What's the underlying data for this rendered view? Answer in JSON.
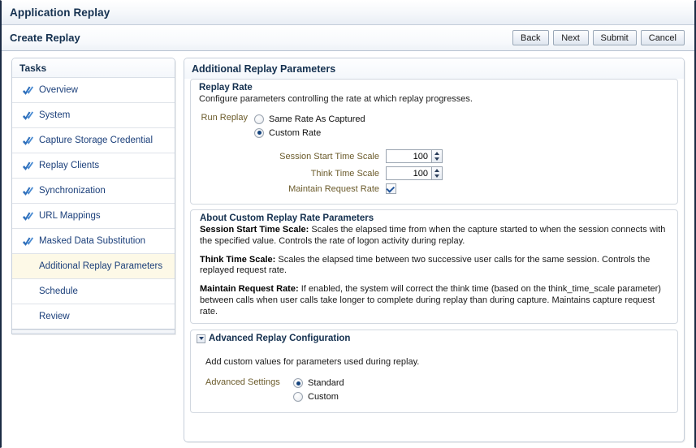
{
  "app": {
    "title": "Application Replay",
    "page_title": "Create Replay"
  },
  "toolbar": {
    "buttons": [
      {
        "label": "Back",
        "name": "back-button"
      },
      {
        "label": "Next",
        "name": "next-button"
      },
      {
        "label": "Submit",
        "name": "submit-button"
      },
      {
        "label": "Cancel",
        "name": "cancel-button"
      }
    ]
  },
  "tasks": {
    "header": "Tasks",
    "items": [
      {
        "label": "Overview",
        "completed": true,
        "selected": false
      },
      {
        "label": "System",
        "completed": true,
        "selected": false
      },
      {
        "label": "Capture Storage Credential",
        "completed": true,
        "selected": false
      },
      {
        "label": "Replay Clients",
        "completed": true,
        "selected": false
      },
      {
        "label": "Synchronization",
        "completed": true,
        "selected": false
      },
      {
        "label": "URL Mappings",
        "completed": true,
        "selected": false
      },
      {
        "label": "Masked Data Substitution",
        "completed": true,
        "selected": false
      },
      {
        "label": "Additional Replay Parameters",
        "completed": false,
        "selected": true
      },
      {
        "label": "Schedule",
        "completed": false,
        "selected": false
      },
      {
        "label": "Review",
        "completed": false,
        "selected": false
      }
    ]
  },
  "main": {
    "header": "Additional Replay Parameters",
    "replay_rate": {
      "title": "Replay Rate",
      "description": "Configure parameters controlling the rate at which replay progresses.",
      "run_replay_label": "Run Replay",
      "options": [
        {
          "label": "Same Rate As Captured",
          "selected": false
        },
        {
          "label": "Custom Rate",
          "selected": true
        }
      ],
      "fields": [
        {
          "label": "Session Start Time Scale",
          "value": "100",
          "type": "spinner"
        },
        {
          "label": "Think Time Scale",
          "value": "100",
          "type": "spinner"
        },
        {
          "label": "Maintain Request Rate",
          "value": "",
          "type": "checkbox",
          "checked": true
        }
      ]
    },
    "about": {
      "title": "About Custom Replay Rate Parameters",
      "paragraphs": [
        {
          "term": "Session Start Time Scale:",
          "text": " Scales the elapsed time from when the capture started to when the session connects with the specified value. Controls the rate of logon activity during replay."
        },
        {
          "term": "Think Time Scale:",
          "text": " Scales the elapsed time between two successive user calls for the same session. Controls the replayed request rate."
        },
        {
          "term": "Maintain Request Rate:",
          "text": " If enabled, the system will correct the think time (based on the think_time_scale parameter) between calls when user calls take longer to complete during replay than during capture. Maintains capture request rate."
        }
      ]
    },
    "advanced": {
      "title": "Advanced Replay Configuration",
      "description": "Add custom values for parameters used during replay.",
      "settings_label": "Advanced Settings",
      "options": [
        {
          "label": "Standard",
          "selected": true
        },
        {
          "label": "Custom",
          "selected": false
        }
      ]
    }
  },
  "colors": {
    "header_blue": "#14304f",
    "link_blue": "#1b3f7a",
    "label_olive": "#6b5b2b",
    "selected_row": "#fdf9e7",
    "radio_dot": "#14447e",
    "check_icon": "#2f6fba"
  }
}
